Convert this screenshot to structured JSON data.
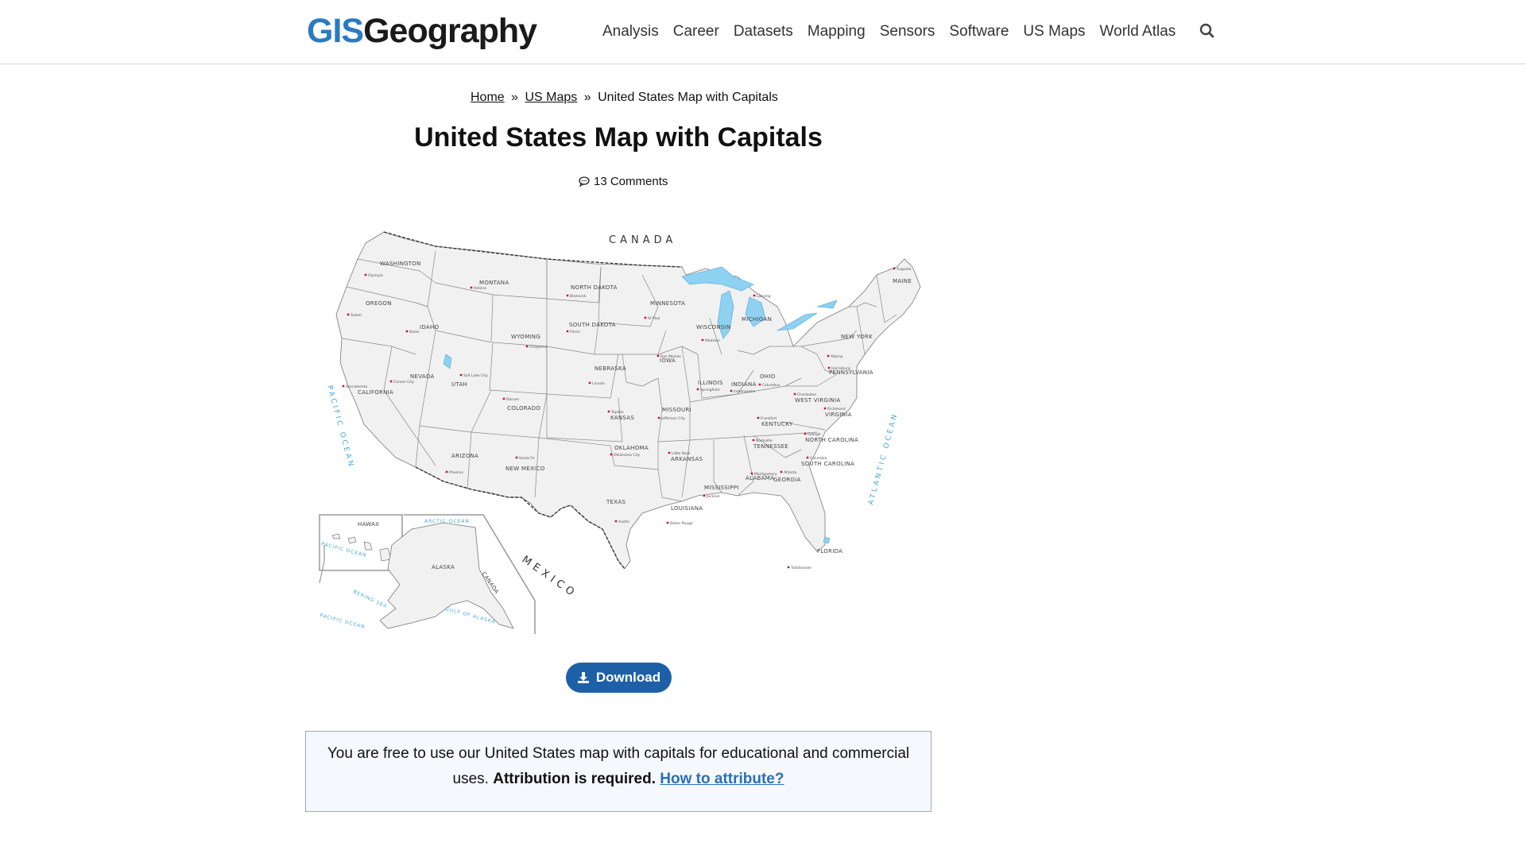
{
  "header": {
    "logo_gis": "GIS",
    "logo_geo": "Geography",
    "nav": [
      "Analysis",
      "Career",
      "Datasets",
      "Mapping",
      "Sensors",
      "Software",
      "US Maps",
      "World Atlas"
    ],
    "search_icon": "search-icon"
  },
  "breadcrumb": {
    "home": "Home",
    "sep1": "»",
    "us_maps": "US Maps",
    "sep2": "»",
    "current": "United States Map with Capitals"
  },
  "page": {
    "title": "United States Map with Capitals",
    "comments": "13 Comments",
    "comment_icon": "comment-icon"
  },
  "map": {
    "country_labels": [
      "CANADA",
      "MEXICO"
    ],
    "ocean_labels": [
      "PACIFIC OCEAN",
      "ATLANTIC OCEAN",
      "ARCTIC OCEAN",
      "PACIFIC OCEAN",
      "BERING SEA",
      "GULF OF ALASKA",
      "PACIFIC OCEAN"
    ],
    "inset_labels": [
      "HAWAII",
      "ALASKA",
      "CANADA"
    ],
    "states": [
      {
        "name": "WASHINGTON",
        "cap": "Olympia"
      },
      {
        "name": "OREGON",
        "cap": "Salem"
      },
      {
        "name": "CALIFORNIA",
        "cap": "Sacramento"
      },
      {
        "name": "NEVADA",
        "cap": "Carson City"
      },
      {
        "name": "IDAHO",
        "cap": "Boise"
      },
      {
        "name": "MONTANA",
        "cap": "Helena"
      },
      {
        "name": "WYOMING",
        "cap": "Cheyenne"
      },
      {
        "name": "UTAH",
        "cap": "Salt Lake City"
      },
      {
        "name": "ARIZONA",
        "cap": "Phoenix"
      },
      {
        "name": "COLORADO",
        "cap": "Denver"
      },
      {
        "name": "NEW MEXICO",
        "cap": "Santa Fe"
      },
      {
        "name": "NORTH DAKOTA",
        "cap": "Bismarck"
      },
      {
        "name": "SOUTH DAKOTA",
        "cap": "Pierre"
      },
      {
        "name": "NEBRASKA",
        "cap": "Lincoln"
      },
      {
        "name": "KANSAS",
        "cap": "Topeka"
      },
      {
        "name": "OKLAHOMA",
        "cap": "Oklahoma City"
      },
      {
        "name": "TEXAS",
        "cap": "Austin"
      },
      {
        "name": "MINNESOTA",
        "cap": "St Paul"
      },
      {
        "name": "IOWA",
        "cap": "Des Moines"
      },
      {
        "name": "MISSOURI",
        "cap": "Jefferson City"
      },
      {
        "name": "ARKANSAS",
        "cap": "Little Rock"
      },
      {
        "name": "LOUISIANA",
        "cap": "Baton Rouge"
      },
      {
        "name": "WISCONSIN",
        "cap": "Madison"
      },
      {
        "name": "ILLINOIS",
        "cap": "Springfield"
      },
      {
        "name": "MICHIGAN",
        "cap": "Lansing"
      },
      {
        "name": "INDIANA",
        "cap": "Indianapolis"
      },
      {
        "name": "OHIO",
        "cap": "Columbus"
      },
      {
        "name": "KENTUCKY",
        "cap": "Frankfort"
      },
      {
        "name": "TENNESSEE",
        "cap": "Nashville"
      },
      {
        "name": "MISSISSIPPI",
        "cap": "Jackson"
      },
      {
        "name": "ALABAMA",
        "cap": "Montgomery"
      },
      {
        "name": "GEORGIA",
        "cap": "Atlanta"
      },
      {
        "name": "FLORIDA",
        "cap": "Tallahassee"
      },
      {
        "name": "SOUTH CAROLINA",
        "cap": "Columbia"
      },
      {
        "name": "NORTH CAROLINA",
        "cap": "Raleigh"
      },
      {
        "name": "VIRGINIA",
        "cap": "Richmond"
      },
      {
        "name": "WEST VIRGINIA",
        "cap": "Charleston"
      },
      {
        "name": "PENNSYLVANIA",
        "cap": "Harrisburg"
      },
      {
        "name": "NEW YORK",
        "cap": "Albany"
      },
      {
        "name": "MAINE",
        "cap": "Augusta"
      }
    ]
  },
  "download": {
    "label": "Download",
    "icon": "download-icon"
  },
  "notice": {
    "text": "You are free to use our United States map with capitals for educational and commercial uses.",
    "bold": "Attribution is required.",
    "link": "How to attribute?"
  }
}
